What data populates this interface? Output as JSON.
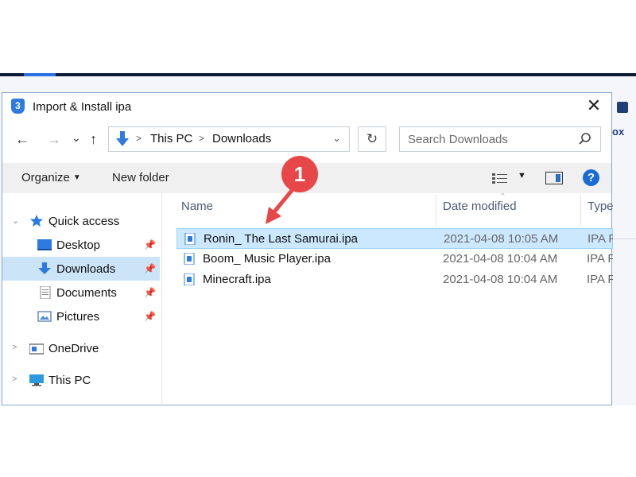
{
  "background_app": {
    "right_label": "ox"
  },
  "dialog": {
    "badge": "3",
    "title": "Import & Install ipa",
    "close_glyph": "✕"
  },
  "nav": {
    "back_glyph": "←",
    "forward_glyph": "→",
    "recent_glyph": "⌄",
    "up_glyph": "↑",
    "breadcrumb": [
      "This PC",
      "Downloads"
    ],
    "chevron": ">",
    "dropdown_glyph": "⌄",
    "refresh_glyph": "↻"
  },
  "search": {
    "placeholder": "Search Downloads"
  },
  "toolbar": {
    "organize_label": "Organize",
    "caret": "▼",
    "new_folder_label": "New folder",
    "help_glyph": "?"
  },
  "sidebar": {
    "expand_glyph": ">",
    "collapse_glyph": "⌄",
    "pin_glyph": "📌",
    "items": [
      {
        "label": "Quick access",
        "icon": "star-icon"
      },
      {
        "label": "Desktop",
        "icon": "desktop-icon",
        "pinned": true
      },
      {
        "label": "Downloads",
        "icon": "download-icon",
        "pinned": true,
        "selected": true
      },
      {
        "label": "Documents",
        "icon": "document-icon",
        "pinned": true
      },
      {
        "label": "Pictures",
        "icon": "pictures-icon",
        "pinned": true
      },
      {
        "label": "OneDrive",
        "icon": "onedrive-icon"
      },
      {
        "label": "This PC",
        "icon": "computer-icon"
      }
    ]
  },
  "columns": {
    "name": "Name",
    "date": "Date modified",
    "type": "Type",
    "sort_glyph": "^"
  },
  "files": [
    {
      "name": "Ronin_ The Last Samurai.ipa",
      "date": "2021-04-08 10:05 AM",
      "type": "IPA F",
      "selected": true
    },
    {
      "name": "Boom_ Music Player.ipa",
      "date": "2021-04-08 10:04 AM",
      "type": "IPA F"
    },
    {
      "name": "Minecraft.ipa",
      "date": "2021-04-08 10:04 AM",
      "type": "IPA F"
    }
  ],
  "annotation": {
    "number": "1"
  },
  "colors": {
    "accent": "#2d7be0",
    "selection": "#cce8ff",
    "callout": "#e8474a"
  }
}
